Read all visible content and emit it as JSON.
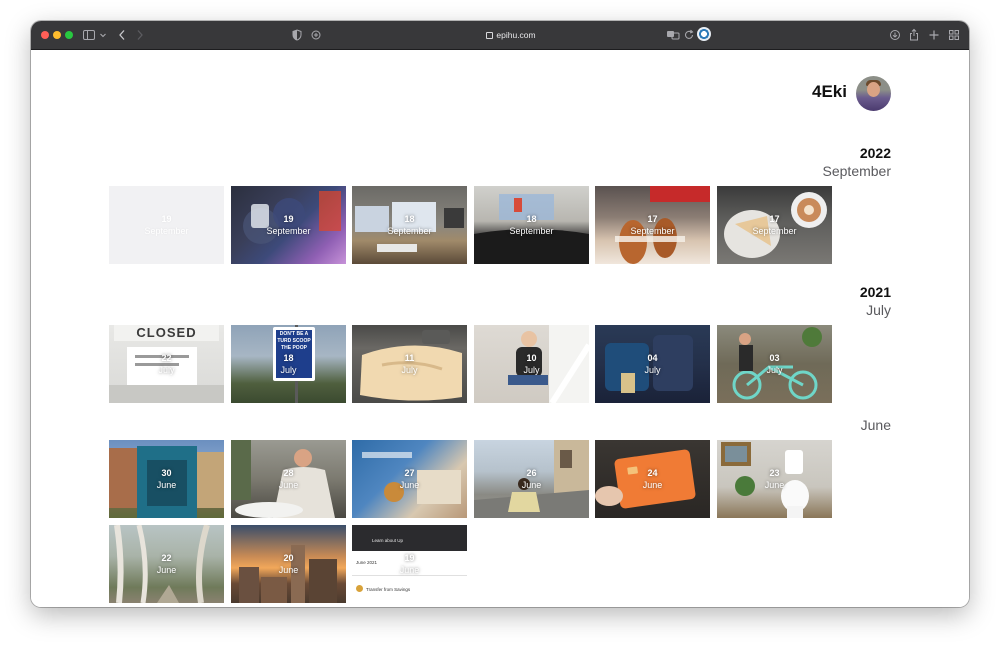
{
  "browser": {
    "url": "epihu.com",
    "icons": [
      "close-icon",
      "minimize-icon",
      "zoom-icon",
      "sidebar-icon",
      "chevron-down-icon",
      "back-icon",
      "forward-icon",
      "privacy-report-icon",
      "extension-icon",
      "translate-icon",
      "reload-icon",
      "downloads-icon",
      "share-icon",
      "new-tab-icon",
      "tab-overview-icon"
    ]
  },
  "profile": {
    "username": "4Eki"
  },
  "sections": [
    {
      "year": "2022",
      "month": "September"
    },
    {
      "year": "2021",
      "month": "July"
    },
    {
      "year": "",
      "month": "June"
    }
  ],
  "photos": {
    "sep2022": [
      {
        "day": "19",
        "month": "September"
      },
      {
        "day": "19",
        "month": "September"
      },
      {
        "day": "18",
        "month": "September"
      },
      {
        "day": "18",
        "month": "September"
      },
      {
        "day": "17",
        "month": "September"
      },
      {
        "day": "17",
        "month": "September"
      }
    ],
    "jul2021": [
      {
        "day": "22",
        "month": "July"
      },
      {
        "day": "18",
        "month": "July"
      },
      {
        "day": "11",
        "month": "July"
      },
      {
        "day": "10",
        "month": "July"
      },
      {
        "day": "04",
        "month": "July"
      },
      {
        "day": "03",
        "month": "July"
      }
    ],
    "jun2021": [
      {
        "day": "30",
        "month": "June"
      },
      {
        "day": "28",
        "month": "June"
      },
      {
        "day": "27",
        "month": "June"
      },
      {
        "day": "26",
        "month": "June"
      },
      {
        "day": "24",
        "month": "June"
      },
      {
        "day": "23",
        "month": "June"
      },
      {
        "day": "22",
        "month": "June"
      },
      {
        "day": "20",
        "month": "June"
      },
      {
        "day": "19",
        "month": "June"
      }
    ]
  },
  "photo_texts": {
    "closed_sign": "CLOSED",
    "street_sign": "DON'T BE A TURD SCOOP THE POOP",
    "app_screenshot": [
      "Learn about Up",
      "June 2021",
      "Transfer from Savings"
    ]
  }
}
